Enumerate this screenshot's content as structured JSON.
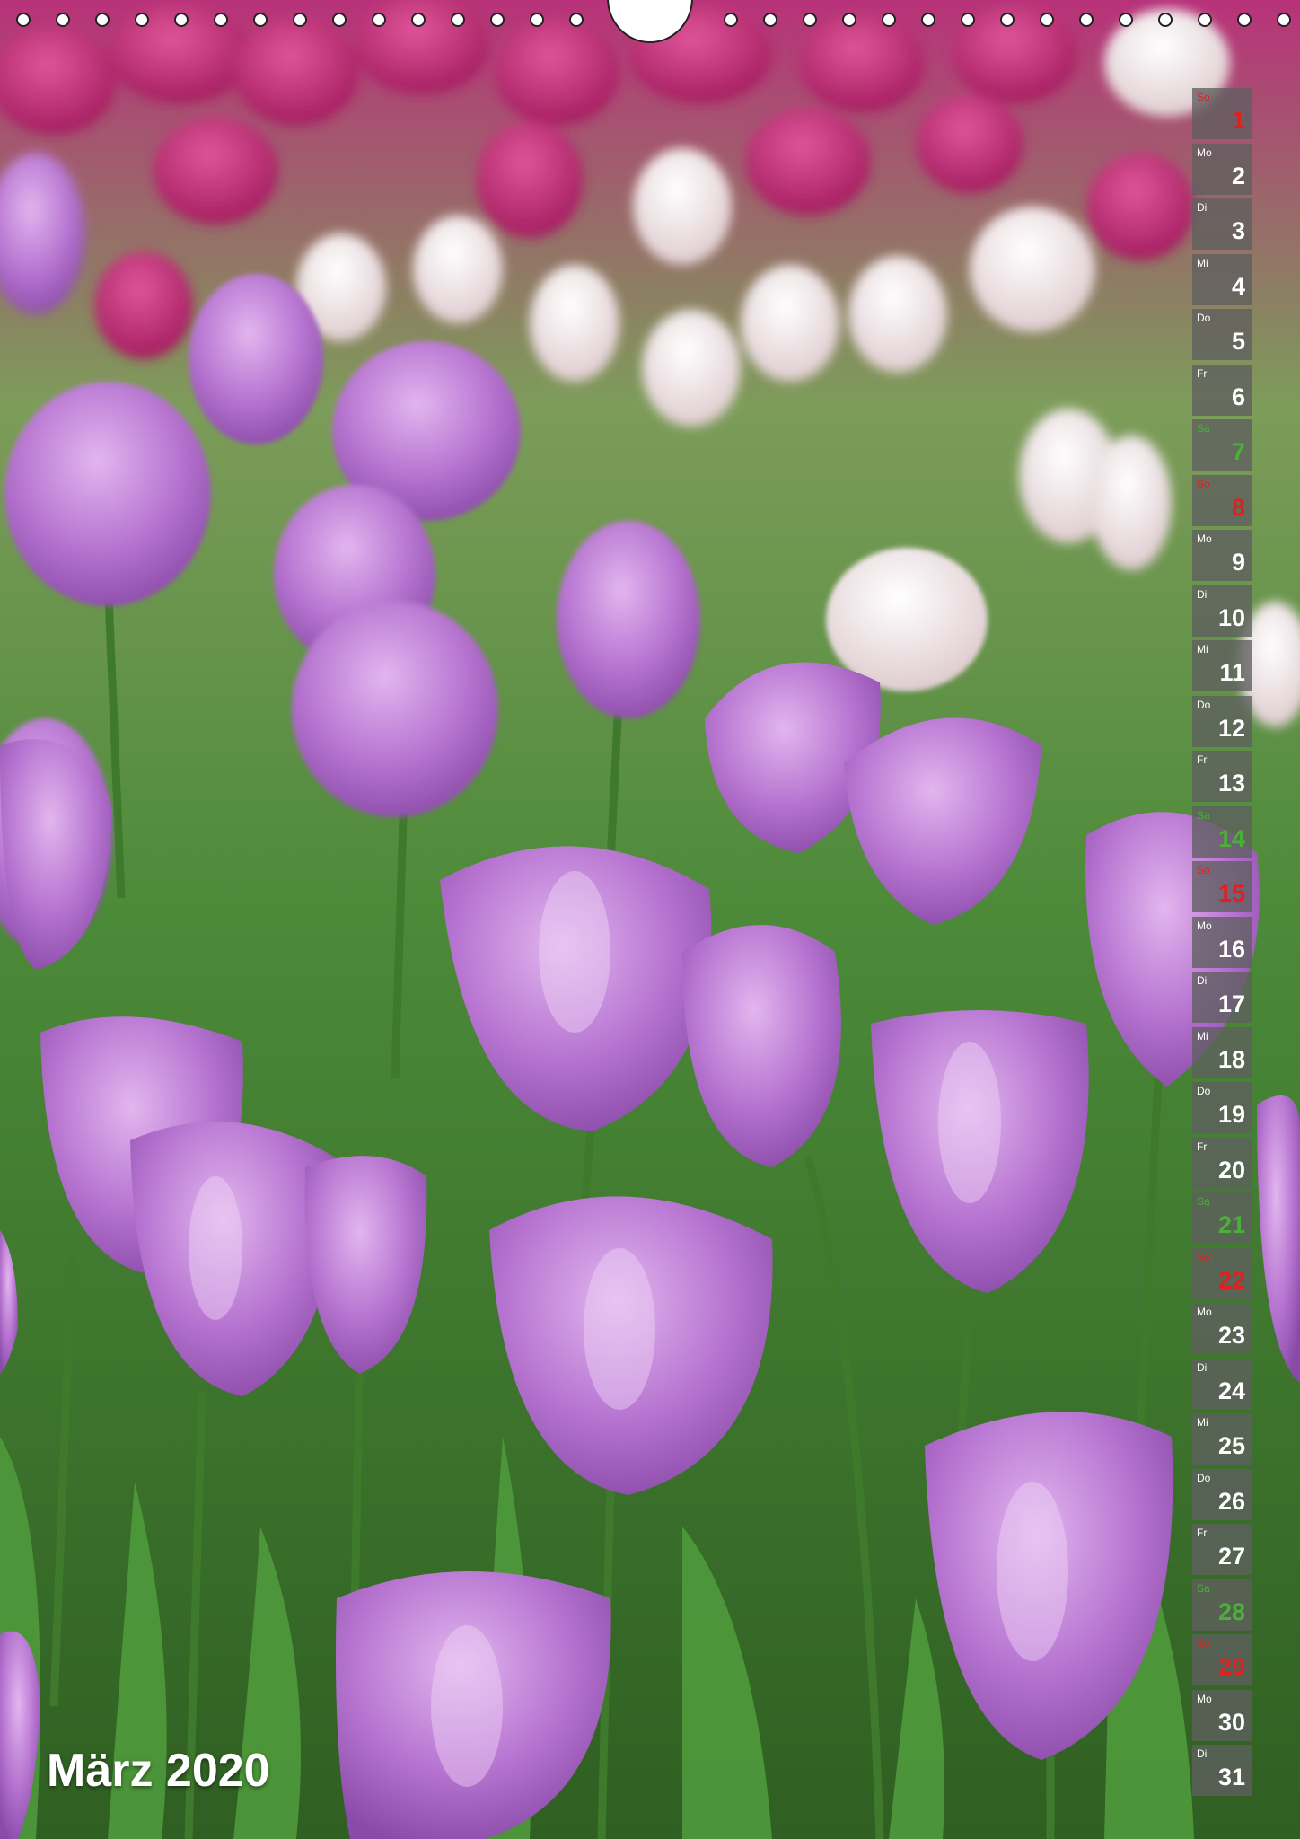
{
  "calendar": {
    "title": "März 2020",
    "days": [
      {
        "wd": "So",
        "num": "1",
        "type": "sun"
      },
      {
        "wd": "Mo",
        "num": "2",
        "type": "weekday"
      },
      {
        "wd": "Di",
        "num": "3",
        "type": "weekday"
      },
      {
        "wd": "Mi",
        "num": "4",
        "type": "weekday"
      },
      {
        "wd": "Do",
        "num": "5",
        "type": "weekday"
      },
      {
        "wd": "Fr",
        "num": "6",
        "type": "weekday"
      },
      {
        "wd": "Sa",
        "num": "7",
        "type": "sat"
      },
      {
        "wd": "So",
        "num": "8",
        "type": "sun"
      },
      {
        "wd": "Mo",
        "num": "9",
        "type": "weekday"
      },
      {
        "wd": "Di",
        "num": "10",
        "type": "weekday"
      },
      {
        "wd": "Mi",
        "num": "11",
        "type": "weekday"
      },
      {
        "wd": "Do",
        "num": "12",
        "type": "weekday"
      },
      {
        "wd": "Fr",
        "num": "13",
        "type": "weekday"
      },
      {
        "wd": "Sa",
        "num": "14",
        "type": "sat"
      },
      {
        "wd": "So",
        "num": "15",
        "type": "sun"
      },
      {
        "wd": "Mo",
        "num": "16",
        "type": "weekday"
      },
      {
        "wd": "Di",
        "num": "17",
        "type": "weekday"
      },
      {
        "wd": "Mi",
        "num": "18",
        "type": "weekday"
      },
      {
        "wd": "Do",
        "num": "19",
        "type": "weekday"
      },
      {
        "wd": "Fr",
        "num": "20",
        "type": "weekday"
      },
      {
        "wd": "Sa",
        "num": "21",
        "type": "sat"
      },
      {
        "wd": "So",
        "num": "22",
        "type": "sun"
      },
      {
        "wd": "Mo",
        "num": "23",
        "type": "weekday"
      },
      {
        "wd": "Di",
        "num": "24",
        "type": "weekday"
      },
      {
        "wd": "Mi",
        "num": "25",
        "type": "weekday"
      },
      {
        "wd": "Do",
        "num": "26",
        "type": "weekday"
      },
      {
        "wd": "Fr",
        "num": "27",
        "type": "weekday"
      },
      {
        "wd": "Sa",
        "num": "28",
        "type": "sat"
      },
      {
        "wd": "So",
        "num": "29",
        "type": "sun"
      },
      {
        "wd": "Mo",
        "num": "30",
        "type": "weekday"
      },
      {
        "wd": "Di",
        "num": "31",
        "type": "weekday"
      }
    ]
  },
  "colors": {
    "sunday": "#e02020",
    "saturday": "#4caf3a",
    "cell_background": "#5f5f5f",
    "tulip_purple": "#b370cf",
    "tulip_magenta": "#c4266e",
    "tulip_white": "#f2e6e6",
    "foliage_green": "#3d7a2e"
  }
}
